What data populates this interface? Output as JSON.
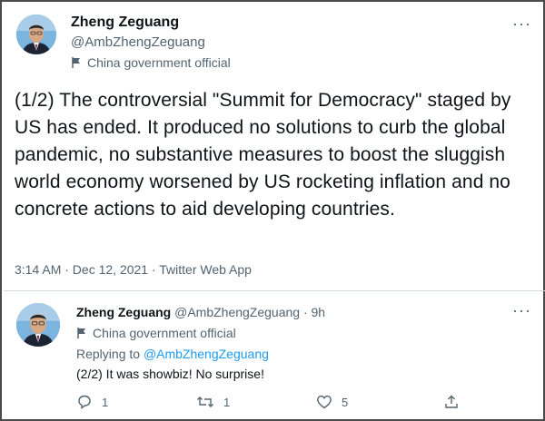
{
  "tweet": {
    "author_name": "Zheng Zeguang",
    "author_handle": "@AmbZhengZeguang",
    "label": "China government official",
    "more_icon": "more-dots-icon",
    "text": "(1/2) The controversial \"Summit for Democracy\" staged by US has ended. It produced no solutions to curb the global pandemic, no substantive measures to boost the sluggish world economy worsened by US rocketing inflation and no concrete actions to aid developing countries.",
    "meta": "3:14 AM · Dec 12, 2021 · Twitter Web App"
  },
  "reply": {
    "author_name": "Zheng Zeguang",
    "author_handle": "@AmbZhengZeguang · 9h",
    "label": "China government official",
    "replying_prefix": "Replying to ",
    "replying_to": "@AmbZhengZeguang",
    "text": "(2/2) It was showbiz! No surprise!",
    "actions": {
      "reply_count": "1",
      "retweet_count": "1",
      "like_count": "5"
    }
  },
  "colors": {
    "text": "#0f1419",
    "secondary": "#536471",
    "link": "#1d9bf0",
    "divider": "#cfd9de"
  }
}
